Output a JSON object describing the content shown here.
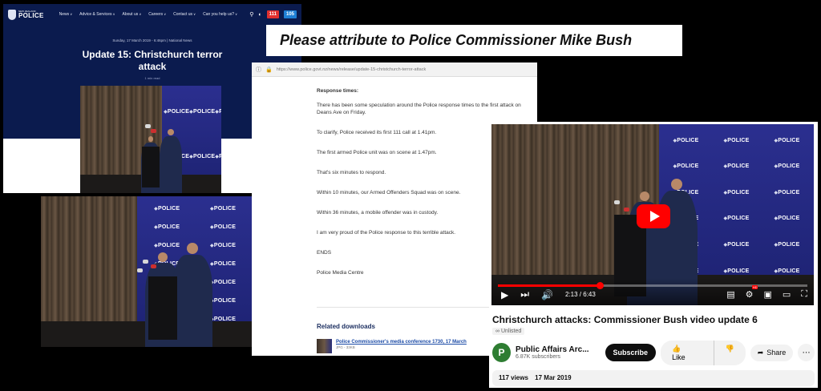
{
  "site": {
    "logo_text": "POLICE",
    "logo_sub": "NEW ZEALAND",
    "nav": [
      "News",
      "Advice & Services",
      "About us",
      "Careers",
      "Contact us",
      "Can you help us?"
    ],
    "btn_111": "111",
    "btn_105": "105",
    "date": "Sunday, 17 March 2019 - 6:46pm | National News",
    "title_line1": "Update 15: Christchurch terror",
    "title_line2": "attack",
    "read_time": "1 min read"
  },
  "photo_backdrop_text": "POLICE",
  "attribution": "Please attribute to Police Commissioner Mike Bush",
  "article": {
    "url": "https://www.police.govt.nz/news/release/update-15-christchurch-terror-attack",
    "paragraphs": [
      "Response times:",
      "There has been some speculation around the Police response times to the first attack on Deans Ave on Friday.",
      "To clarify, Police received its first 111 call at 1.41pm.",
      "The first armed Police unit was on scene at 1.47pm.",
      "That's six minutes to respond.",
      "Within 10 minutes, our Armed Offenders Squad was on scene.",
      "Within 36 minutes, a mobile offender was in custody.",
      "I am very proud of the Police response to this terrible attack.",
      "ENDS",
      "Police Media Centre"
    ],
    "related_title": "Related downloads",
    "download_link": "Police Commissioner's media conference 1730, 17 March",
    "download_meta": "JPG - 33KB"
  },
  "youtube": {
    "time_current": "2:13",
    "time_total": "6:43",
    "progress": 0.33,
    "title": "Christchurch attacks: Commissioner Bush video update 6",
    "visibility": "Unlisted",
    "channel_initial": "P",
    "channel_name": "Public Affairs Arc...",
    "subscribers": "6.87K subscribers",
    "subscribe_label": "Subscribe",
    "like_label": "Like",
    "share_label": "Share",
    "views": "117 views",
    "upload_date": "17 Mar 2019",
    "accent": "#ff0000"
  }
}
